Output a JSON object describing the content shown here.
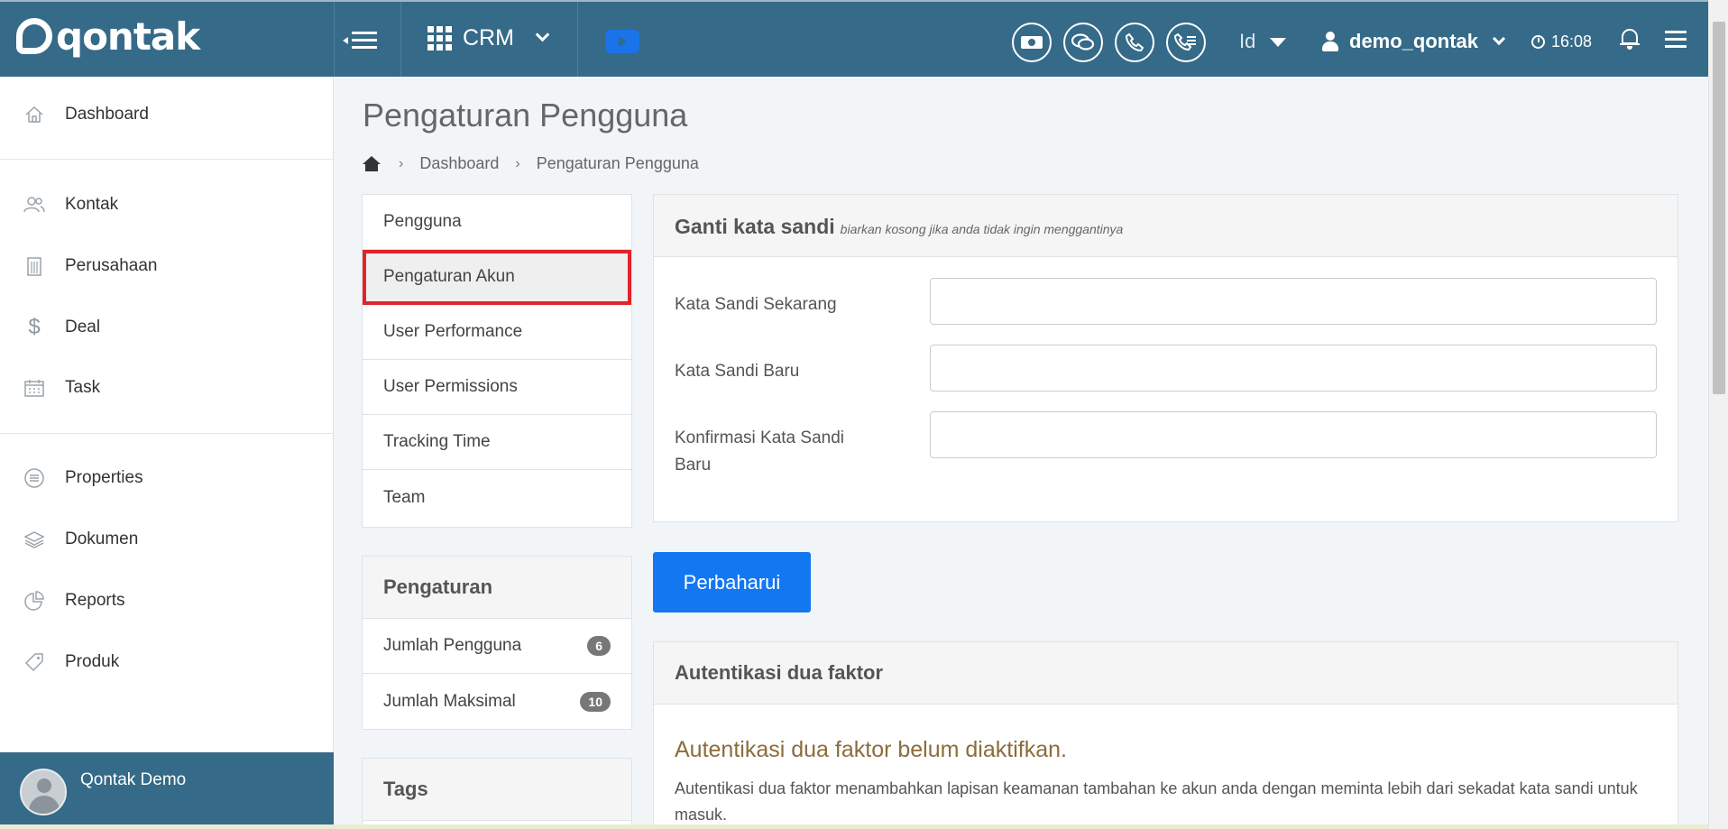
{
  "topbar": {
    "logo_text": "qontak",
    "app_switcher": "CRM",
    "lang": "Id",
    "username": "demo_qontak",
    "time": "16:08",
    "icons": [
      "menu-collapse-icon",
      "apps-grid-icon",
      "youtube-icon",
      "money-icon",
      "chat-icon",
      "phone-icon",
      "call-log-icon",
      "user-icon",
      "clock-icon",
      "bell-icon",
      "hamburger-icon"
    ]
  },
  "sidebar": {
    "items": [
      {
        "label": "Dashboard",
        "icon": "home-icon"
      },
      {
        "label": "Kontak",
        "icon": "contacts-icon"
      },
      {
        "label": "Perusahaan",
        "icon": "building-icon"
      },
      {
        "label": "Deal",
        "icon": "dollar-icon"
      },
      {
        "label": "Task",
        "icon": "calendar-icon"
      },
      {
        "label": "Properties",
        "icon": "list-icon"
      },
      {
        "label": "Dokumen",
        "icon": "layers-icon"
      },
      {
        "label": "Reports",
        "icon": "pie-chart-icon"
      },
      {
        "label": "Produk",
        "icon": "tag-icon"
      }
    ],
    "profile_name": "Qontak Demo"
  },
  "page": {
    "title": "Pengaturan Pengguna",
    "breadcrumb": [
      "Dashboard",
      "Pengaturan Pengguna"
    ]
  },
  "settings_menu": {
    "items": [
      "Pengguna",
      "Pengaturan Akun",
      "User Performance",
      "User Permissions",
      "Tracking Time",
      "Team"
    ],
    "active": "Pengaturan Akun"
  },
  "pengaturan": {
    "title": "Pengaturan",
    "rows": [
      {
        "label": "Jumlah Pengguna",
        "count": "6"
      },
      {
        "label": "Jumlah Maksimal",
        "count": "10"
      }
    ]
  },
  "tags": {
    "title": "Tags"
  },
  "password_form": {
    "title": "Ganti kata sandi",
    "hint": "biarkan kosong jika anda tidak ingin menggantinya",
    "fields": [
      {
        "label": "Kata Sandi Sekarang",
        "value": ""
      },
      {
        "label": "Kata Sandi Baru",
        "value": ""
      },
      {
        "label": "Konfirmasi Kata Sandi Baru",
        "value": ""
      }
    ],
    "submit_label": "Perbaharui"
  },
  "two_factor": {
    "title": "Autentikasi dua faktor",
    "status": "Autentikasi dua faktor belum diaktifkan.",
    "description": "Autentikasi dua faktor menambahkan lapisan keamanan tambahan ke akun anda dengan meminta lebih dari sekadat kata sandi untuk masuk."
  },
  "colors": {
    "topbar": "#356a88",
    "primary_button": "#1477f2",
    "active_outline": "#e2232a",
    "warning_text": "#8a6d3b"
  }
}
